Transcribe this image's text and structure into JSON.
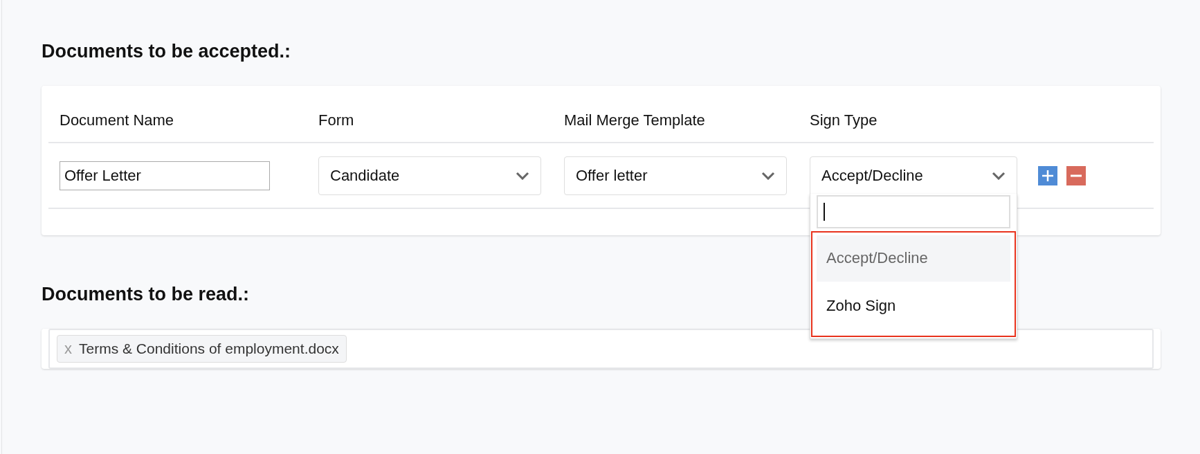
{
  "accepted_documents": {
    "title": "Documents to be accepted.:",
    "columns": [
      "Document Name",
      "Form",
      "Mail Merge Template",
      "Sign Type"
    ],
    "rows": [
      {
        "cells": [
          {
            "kind": "text",
            "value": "Offer Letter"
          },
          {
            "kind": "select",
            "value": "Candidate",
            "open": false
          },
          {
            "kind": "select",
            "value": "Offer letter",
            "open": false
          },
          {
            "kind": "select",
            "value": "Accept/Decline",
            "open": true,
            "options": [
              {
                "label": "Accept/Decline",
                "selected": true
              },
              {
                "label": "Zoho Sign",
                "selected": false
              }
            ]
          }
        ]
      }
    ]
  },
  "read_documents": {
    "title": "Documents to be read.:",
    "tags": [
      {
        "remove": "x",
        "label": "Terms & Conditions of employment.docx"
      }
    ]
  }
}
